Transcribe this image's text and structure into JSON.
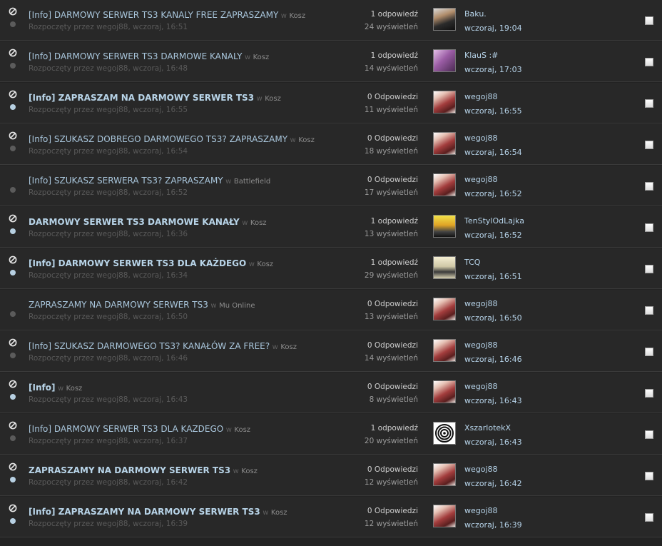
{
  "in_word": "w",
  "topics": [
    {
      "prefix": "[Info]",
      "title": " DARMOWY SERWER TS3 KANALY FREE ZAPRASZAMY",
      "forum": "Kosz",
      "started": "Rozpoczęty przez wegoj88, wczoraj, 16:51",
      "replies": "1 odpowiedź",
      "views": "24 wyświetleń",
      "last_user": "Baku.",
      "last_date": "wczoraj, 19:04",
      "bold": false,
      "dot": "read",
      "icon": true,
      "avatar": "baku"
    },
    {
      "prefix": "[Info]",
      "title": " DARMOWY SERWER TS3 DARMOWE KANALY",
      "forum": "Kosz",
      "started": "Rozpoczęty przez wegoj88, wczoraj, 16:48",
      "replies": "1 odpowiedź",
      "views": "14 wyświetleń",
      "last_user": "KlauS :#",
      "last_date": "wczoraj, 17:03",
      "bold": false,
      "dot": "read",
      "icon": true,
      "avatar": "klaus"
    },
    {
      "prefix": "[Info]",
      "title": " ZAPRASZAM NA DARMOWY SERWER TS3",
      "forum": "Kosz",
      "started": "Rozpoczęty przez wegoj88, wczoraj, 16:55",
      "replies": "0 Odpowiedzi",
      "views": "11 wyświetleń",
      "last_user": "wegoj88",
      "last_date": "wczoraj, 16:55",
      "bold": true,
      "dot": "unread",
      "icon": true,
      "avatar": "wegoj"
    },
    {
      "prefix": "[Info]",
      "title": " SZUKASZ DOBREGO DARMOWEGO TS3? ZAPRASZAMY",
      "forum": "Kosz",
      "started": "Rozpoczęty przez wegoj88, wczoraj, 16:54",
      "replies": "0 Odpowiedzi",
      "views": "18 wyświetleń",
      "last_user": "wegoj88",
      "last_date": "wczoraj, 16:54",
      "bold": false,
      "dot": "read",
      "icon": true,
      "avatar": "wegoj"
    },
    {
      "prefix": "[Info]",
      "title": " SZUKASZ SERWERA TS3? ZAPRASZAMY",
      "forum": "Battlefield",
      "started": "Rozpoczęty przez wegoj88, wczoraj, 16:52",
      "replies": "0 Odpowiedzi",
      "views": "17 wyświetleń",
      "last_user": "wegoj88",
      "last_date": "wczoraj, 16:52",
      "bold": false,
      "dot": "read",
      "icon": false,
      "avatar": "wegoj"
    },
    {
      "prefix": "",
      "title": "DARMOWY SERWER TS3 DARMOWE KANAŁY",
      "forum": "Kosz",
      "started": "Rozpoczęty przez wegoj88, wczoraj, 16:36",
      "replies": "1 odpowiedź",
      "views": "13 wyświetleń",
      "last_user": "TenStylOdLajka",
      "last_date": "wczoraj, 16:52",
      "bold": true,
      "dot": "unread",
      "icon": true,
      "avatar": "ten"
    },
    {
      "prefix": "[Info]",
      "title": " DARMOWY SERWER TS3 DLA KAŻDEGO",
      "forum": "Kosz",
      "started": "Rozpoczęty przez wegoj88, wczoraj, 16:34",
      "replies": "1 odpowiedź",
      "views": "29 wyświetleń",
      "last_user": "TCQ",
      "last_date": "wczoraj, 16:51",
      "bold": true,
      "dot": "unread",
      "icon": true,
      "avatar": "tcq"
    },
    {
      "prefix": "",
      "title": "ZAPRASZAMY NA DARMOWY SERWER TS3",
      "forum": "Mu Online",
      "started": "Rozpoczęty przez wegoj88, wczoraj, 16:50",
      "replies": "0 Odpowiedzi",
      "views": "13 wyświetleń",
      "last_user": "wegoj88",
      "last_date": "wczoraj, 16:50",
      "bold": false,
      "dot": "read",
      "icon": false,
      "avatar": "wegoj"
    },
    {
      "prefix": "[Info]",
      "title": " SZUKASZ DARMOWEGO TS3? KANAŁÓW ZA FREE?",
      "forum": "Kosz",
      "started": "Rozpoczęty przez wegoj88, wczoraj, 16:46",
      "replies": "0 Odpowiedzi",
      "views": "14 wyświetleń",
      "last_user": "wegoj88",
      "last_date": "wczoraj, 16:46",
      "bold": false,
      "dot": "read",
      "icon": true,
      "avatar": "wegoj"
    },
    {
      "prefix": "[Info]",
      "title": "",
      "forum": "Kosz",
      "started": "Rozpoczęty przez wegoj88, wczoraj, 16:43",
      "replies": "0 Odpowiedzi",
      "views": "8 wyświetleń",
      "last_user": "wegoj88",
      "last_date": "wczoraj, 16:43",
      "bold": true,
      "dot": "unread",
      "icon": true,
      "avatar": "wegoj"
    },
    {
      "prefix": "[Info]",
      "title": " DARMOWY SERWER TS3 DLA KAZDEGO",
      "forum": "Kosz",
      "started": "Rozpoczęty przez wegoj88, wczoraj, 16:37",
      "replies": "1 odpowiedź",
      "views": "20 wyświetleń",
      "last_user": "XszarlotekX",
      "last_date": "wczoraj, 16:43",
      "bold": false,
      "dot": "read",
      "icon": true,
      "avatar": "xs"
    },
    {
      "prefix": "",
      "title": "ZAPRASZAMY NA DARMOWY SERWER TS3",
      "forum": "Kosz",
      "started": "Rozpoczęty przez wegoj88, wczoraj, 16:42",
      "replies": "0 Odpowiedzi",
      "views": "12 wyświetleń",
      "last_user": "wegoj88",
      "last_date": "wczoraj, 16:42",
      "bold": true,
      "dot": "unread",
      "icon": true,
      "avatar": "wegoj"
    },
    {
      "prefix": "[Info]",
      "title": " ZAPRASZAMY NA DARMOWY SERWER TS3",
      "forum": "Kosz",
      "started": "Rozpoczęty przez wegoj88, wczoraj, 16:39",
      "replies": "0 Odpowiedzi",
      "views": "12 wyświetleń",
      "last_user": "wegoj88",
      "last_date": "wczoraj, 16:39",
      "bold": true,
      "dot": "unread",
      "icon": true,
      "avatar": "wegoj"
    }
  ]
}
